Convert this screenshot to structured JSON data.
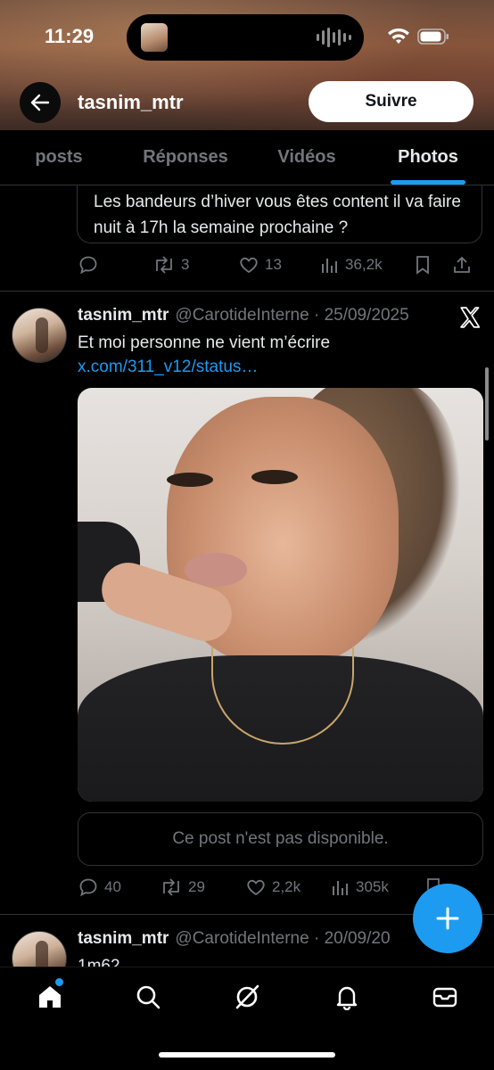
{
  "status_bar": {
    "time": "11:29"
  },
  "header": {
    "username": "tasnim_mtr",
    "follow_label": "Suivre"
  },
  "tabs": [
    {
      "label": "posts",
      "active": false
    },
    {
      "label": "Réponses",
      "active": false
    },
    {
      "label": "Vidéos",
      "active": false
    },
    {
      "label": "Photos",
      "active": true
    }
  ],
  "prev_post": {
    "quote_text": "Les bandeurs d’hiver vous êtes content il va faire nuit à 17h la semaine prochaine ?",
    "stats": {
      "replies": "",
      "reposts": "3",
      "likes": "13",
      "views": "36,2k"
    }
  },
  "tweet1": {
    "name": "tasnim_mtr",
    "handle": "@CarotideInterne · 25/09/2025",
    "text": "Et moi personne ne vient m’écrire ",
    "link": "x.com/311_v12/status…",
    "unavailable": "Ce post n'est pas disponible.",
    "stats": {
      "replies": "40",
      "reposts": "29",
      "likes": "2,2k",
      "views": "305k"
    }
  },
  "tweet2": {
    "name": "tasnim_mtr",
    "handle": "@CarotideInterne · 20/09/20",
    "text": "1m62"
  },
  "colors": {
    "accent": "#1d9bf0",
    "muted": "#71767b",
    "border": "#2f3336"
  },
  "icons": [
    "back-arrow-icon",
    "x-logo-icon",
    "reply-icon",
    "repost-icon",
    "like-icon",
    "views-icon",
    "bookmark-icon",
    "share-icon",
    "compose-icon",
    "home-icon",
    "search-icon",
    "grok-icon",
    "notifications-icon",
    "messages-icon"
  ]
}
